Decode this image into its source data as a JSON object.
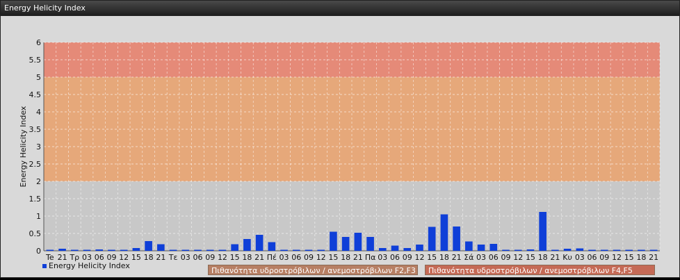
{
  "window": {
    "title": "Energy Helicity Index"
  },
  "chart_data": {
    "type": "bar",
    "ylabel": "Energy Helicity Index",
    "ylim": [
      0,
      6
    ],
    "yticks": [
      "0",
      "0.5",
      "1",
      "1.5",
      "2",
      "2.5",
      "3",
      "3.5",
      "4",
      "4.5",
      "5",
      "5.5",
      "6"
    ],
    "bands": [
      {
        "from": 0,
        "to": 2,
        "color": "#c8c8c8"
      },
      {
        "from": 2,
        "to": 5,
        "color": "#e6a87a"
      },
      {
        "from": 5,
        "to": 6,
        "color": "#e58a78"
      }
    ],
    "categories": [
      "Te",
      "21",
      "Τρ",
      "03",
      "06",
      "09",
      "12",
      "15",
      "18",
      "21",
      "Τε",
      "03",
      "06",
      "09",
      "12",
      "15",
      "18",
      "21",
      "Πέ",
      "03",
      "06",
      "09",
      "12",
      "15",
      "18",
      "21",
      "Πα",
      "03",
      "06",
      "09",
      "12",
      "15",
      "18",
      "21",
      "Σά",
      "03",
      "06",
      "09",
      "12",
      "15",
      "18",
      "21",
      "Κυ",
      "03",
      "06",
      "09",
      "12",
      "15",
      "18",
      "21"
    ],
    "series": [
      {
        "name": "Energy Helicity Index",
        "color": "#0f3fd8",
        "values": [
          0.02,
          0.06,
          0.02,
          0.02,
          0.04,
          0.02,
          0.02,
          0.08,
          0.28,
          0.19,
          0.02,
          0.02,
          0.02,
          0.02,
          0.02,
          0.19,
          0.34,
          0.46,
          0.25,
          0.02,
          0.02,
          0.02,
          0.02,
          0.55,
          0.4,
          0.52,
          0.4,
          0.08,
          0.15,
          0.08,
          0.18,
          0.69,
          1.05,
          0.7,
          0.27,
          0.18,
          0.2,
          0.02,
          0.02,
          0.04,
          1.12,
          0.02,
          0.06,
          0.07,
          0.02,
          0.02,
          0.02,
          0.02,
          0.02,
          0.02
        ]
      }
    ],
    "legend": [
      "Πιθανότητα υδροστρόβιλων / ανεμοστρόβιλων F2,F3",
      "Πιθανότητα υδροστρόβιλων / ανεμοστρόβιλων F4,F5"
    ],
    "grid": true
  }
}
